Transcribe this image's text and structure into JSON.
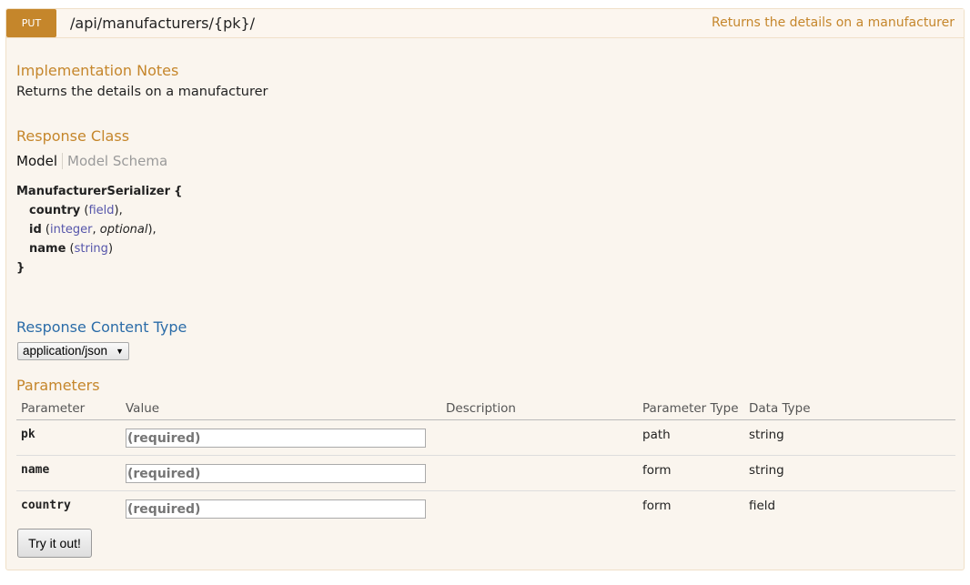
{
  "operation": {
    "method": "PUT",
    "path": "/api/manufacturers/{pk}/",
    "summary": "Returns the details on a manufacturer"
  },
  "implementation_notes": {
    "heading": "Implementation Notes",
    "text": "Returns the details on a manufacturer"
  },
  "response_class": {
    "heading": "Response Class",
    "tabs": {
      "model": "Model",
      "schema": "Model Schema"
    },
    "model_name": "ManufacturerSerializer",
    "open_brace": "{",
    "close_brace": "}",
    "fields": [
      {
        "name": "country",
        "type": "field",
        "optional": "",
        "suffix": "),"
      },
      {
        "name": "id",
        "type": "integer",
        "optional": "optional",
        "suffix": "),"
      },
      {
        "name": "name",
        "type": "string",
        "optional": "",
        "suffix": ")"
      }
    ]
  },
  "response_content_type": {
    "heading": "Response Content Type",
    "selected": "application/json"
  },
  "parameters": {
    "heading": "Parameters",
    "columns": [
      "Parameter",
      "Value",
      "Description",
      "Parameter Type",
      "Data Type"
    ],
    "rows": [
      {
        "name": "pk",
        "placeholder": "(required)",
        "description": "",
        "param_type": "path",
        "data_type": "string"
      },
      {
        "name": "name",
        "placeholder": "(required)",
        "description": "",
        "param_type": "form",
        "data_type": "string"
      },
      {
        "name": "country",
        "placeholder": "(required)",
        "description": "",
        "param_type": "form",
        "data_type": "field"
      }
    ]
  },
  "try_button": "Try it out!"
}
